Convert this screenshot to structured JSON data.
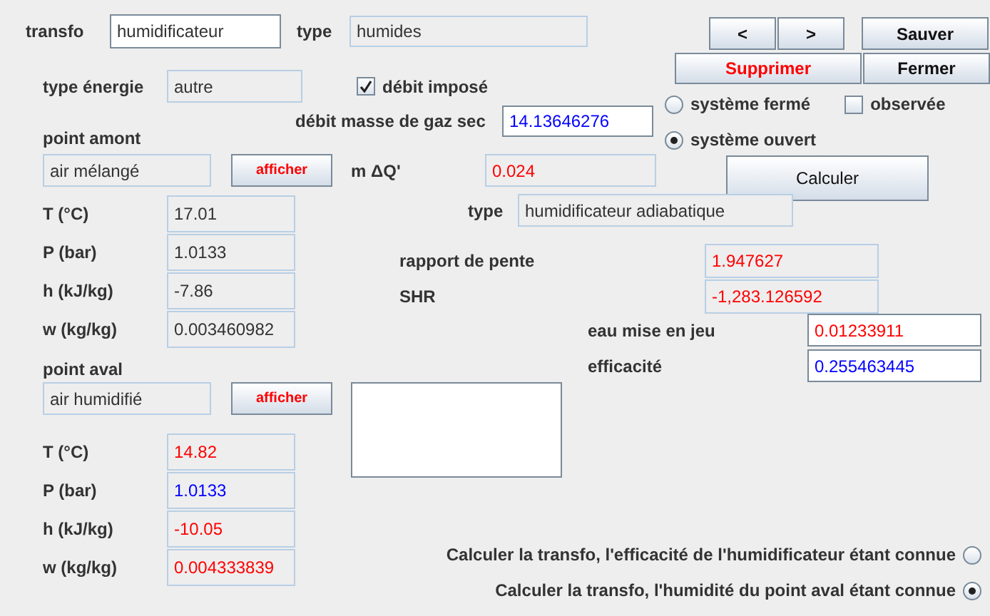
{
  "transfo": {
    "label": "transfo",
    "value": "humidificateur"
  },
  "type": {
    "label": "type",
    "value": "humides"
  },
  "nav_buttons": [
    {
      "label": "<"
    },
    {
      "label": ">"
    }
  ],
  "buttons": {
    "save": "Sauver",
    "delete": "Supprimer",
    "close": "Fermer",
    "compute": "Calculer"
  },
  "energy_type": {
    "label": "type énergie",
    "value": "autre"
  },
  "imposed_flow": {
    "label": "débit imposé",
    "checked": true
  },
  "dry_gas_flow": {
    "label": "débit masse de gaz sec",
    "value": "14.13646276",
    "color": "#0000ff"
  },
  "system": [
    {
      "label": "système fermé",
      "selected": false
    },
    {
      "label": "système ouvert",
      "selected": true
    }
  ],
  "observed": {
    "label": "observée",
    "checked": false
  },
  "upstream": {
    "label": "point amont",
    "value": "air mélangé",
    "button": "afficher",
    "properties": [
      {
        "label": "T (°C)",
        "value": "17.01",
        "color": "#333333"
      },
      {
        "label": "P (bar)",
        "value": "1.0133",
        "color": "#333333"
      },
      {
        "label": "h (kJ/kg)",
        "value": "-7.86",
        "color": "#333333"
      },
      {
        "label": "w (kg/kg)",
        "value": "0.003460982",
        "color": "#333333"
      }
    ]
  },
  "heat": {
    "label": "m ΔQ'",
    "value": "0.024",
    "color": "#ff0000"
  },
  "process_type": {
    "label": "type",
    "value": "humidificateur adiabatique"
  },
  "results": [
    {
      "label": "rapport de pente",
      "value": "1.947627",
      "color": "#ff0000"
    },
    {
      "label": "SHR",
      "value": "-1,283.126592",
      "color": "#ff0000"
    }
  ],
  "inputs": [
    {
      "label": "eau mise en jeu",
      "value": "0.01233911",
      "color": "#ff0000"
    },
    {
      "label": "efficacité",
      "value": "0.255463445",
      "color": "#0000ff"
    }
  ],
  "downstream": {
    "label": "point aval",
    "value": "air humidifié",
    "button": "afficher",
    "properties": [
      {
        "label": "T (°C)",
        "value": "14.82",
        "color": "#ff0000"
      },
      {
        "label": "P (bar)",
        "value": "1.0133",
        "color": "#0000ff"
      },
      {
        "label": "h (kJ/kg)",
        "value": "-10.05",
        "color": "#ff0000"
      },
      {
        "label": "w (kg/kg)",
        "value": "0.004333839",
        "color": "#ff0000"
      }
    ]
  },
  "mode": [
    {
      "label": "Calculer la transfo, l'efficacité de l'humidificateur étant connue",
      "selected": false
    },
    {
      "label": "Calculer la transfo, l'humidité du point aval étant connue",
      "selected": true
    }
  ]
}
